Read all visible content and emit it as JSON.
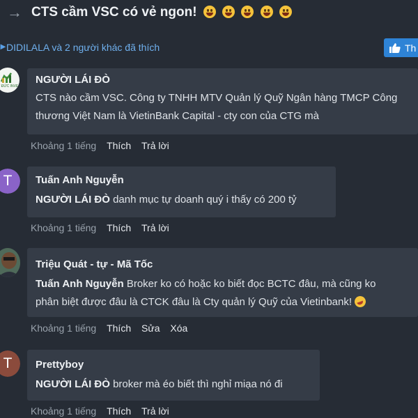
{
  "thread": {
    "title": "CTS cầm VSC có vẻ ngon!",
    "emoji_count": 5
  },
  "likes": {
    "text": "DIDILALA và 2 người khác đã thích",
    "button_label": "Th"
  },
  "comments": [
    {
      "author": "NGƯỜI LÁI ĐÒ",
      "avatar_text": "",
      "avatar_caption": "VIỆT ĐỨC INVEST",
      "mention": "",
      "text": "CTS nào cầm VSC. Công ty TNHH MTV Quản lý Quỹ Ngân hàng TMCP Công thương Việt Nam là VietinBank Capital - cty con của CTG mà",
      "time": "Khoảng 1 tiếng",
      "actions": [
        "Thích",
        "Trả lời"
      ]
    },
    {
      "author": "Tuấn Anh Nguyễn",
      "avatar_text": "T",
      "avatar_color": "#8a63c8",
      "mention": "NGƯỜI LÁI ĐÒ",
      "text": "danh mục tự doanh quý i thấy có 200 tỷ",
      "time": "Khoảng 1 tiếng",
      "actions": [
        "Thích",
        "Trả lời"
      ]
    },
    {
      "author": "Triệu Quát - tự - Mã Tốc",
      "avatar_text": "",
      "mention": "Tuấn Anh Nguyễn",
      "text_line1": "Broker ko có hoặc ko biết đọc BCTC đâu, mà cũng ko",
      "text_line2": "phân biệt được đâu là CTCK đâu là Cty quản lý Quỹ của Vietinbank!",
      "time": "Khoảng 1 tiếng",
      "actions": [
        "Thích",
        "Sửa",
        "Xóa"
      ]
    },
    {
      "author": "Prettyboy",
      "avatar_text": "T",
      "avatar_color": "#8b4b3c",
      "mention": "NGƯỜI LÁI ĐÒ",
      "text": "broker mà éo biết thì nghỉ miạa nó đi",
      "time": "Khoảng 1 tiếng",
      "actions": [
        "Thích",
        "Trả lời"
      ]
    }
  ],
  "colors": {
    "background": "#262c35",
    "bubble": "#353c47",
    "link": "#6fb0ee",
    "like_button": "#2e83d6"
  }
}
